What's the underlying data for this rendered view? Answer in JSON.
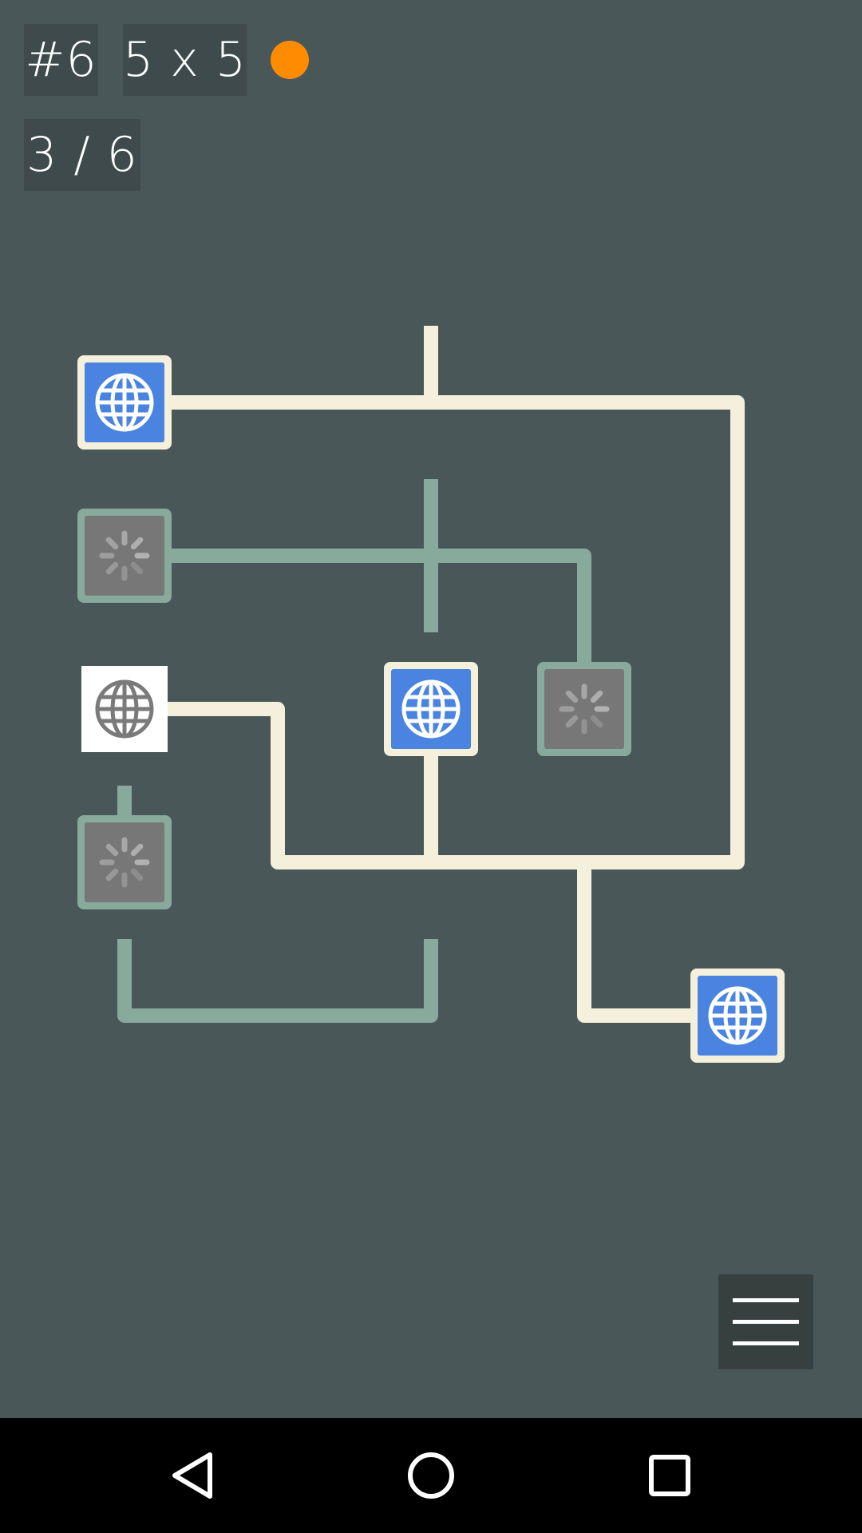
{
  "hud": {
    "level": "#6",
    "grid_size": "5 x 5",
    "progress": "3 / 6",
    "status_dot_color": "#ff8c00"
  },
  "colors": {
    "background": "#4a5759",
    "wire_powered": "#f5f0dc",
    "wire_unpowered": "#87aa9d",
    "node_active_fill": "#4a84e0",
    "node_inactive_fill": "#777777",
    "source_fill": "#ffffff"
  },
  "board": {
    "rows": 5,
    "cols": 5,
    "tiles": [
      {
        "row": 0,
        "col": 0,
        "kind": "computer",
        "powered": true,
        "icon": "globe-icon"
      },
      {
        "row": 0,
        "col": 2,
        "kind": "wire",
        "powered": true
      },
      {
        "row": 0,
        "col": 4,
        "kind": "wire",
        "powered": true
      },
      {
        "row": 1,
        "col": 0,
        "kind": "computer",
        "powered": false,
        "icon": "loading-spinner-icon"
      },
      {
        "row": 1,
        "col": 2,
        "kind": "wire",
        "powered": false
      },
      {
        "row": 1,
        "col": 3,
        "kind": "wire",
        "powered": false
      },
      {
        "row": 2,
        "col": 0,
        "kind": "server",
        "powered": true,
        "icon": "globe-icon"
      },
      {
        "row": 2,
        "col": 2,
        "kind": "computer",
        "powered": true,
        "icon": "globe-icon"
      },
      {
        "row": 2,
        "col": 3,
        "kind": "computer",
        "powered": false,
        "icon": "loading-spinner-icon"
      },
      {
        "row": 3,
        "col": 0,
        "kind": "computer",
        "powered": false,
        "icon": "loading-spinner-icon"
      },
      {
        "row": 3,
        "col": 1,
        "kind": "wire",
        "powered": true
      },
      {
        "row": 3,
        "col": 3,
        "kind": "wire",
        "powered": true
      },
      {
        "row": 4,
        "col": 0,
        "kind": "wire",
        "powered": false
      },
      {
        "row": 4,
        "col": 2,
        "kind": "wire",
        "powered": false
      },
      {
        "row": 4,
        "col": 4,
        "kind": "computer",
        "powered": true,
        "icon": "globe-icon"
      }
    ]
  },
  "menu_icon": "hamburger-menu-icon",
  "nav": [
    {
      "name": "back-button",
      "icon": "triangle-back-icon"
    },
    {
      "name": "home-button",
      "icon": "circle-home-icon"
    },
    {
      "name": "recents-button",
      "icon": "square-recents-icon"
    }
  ]
}
